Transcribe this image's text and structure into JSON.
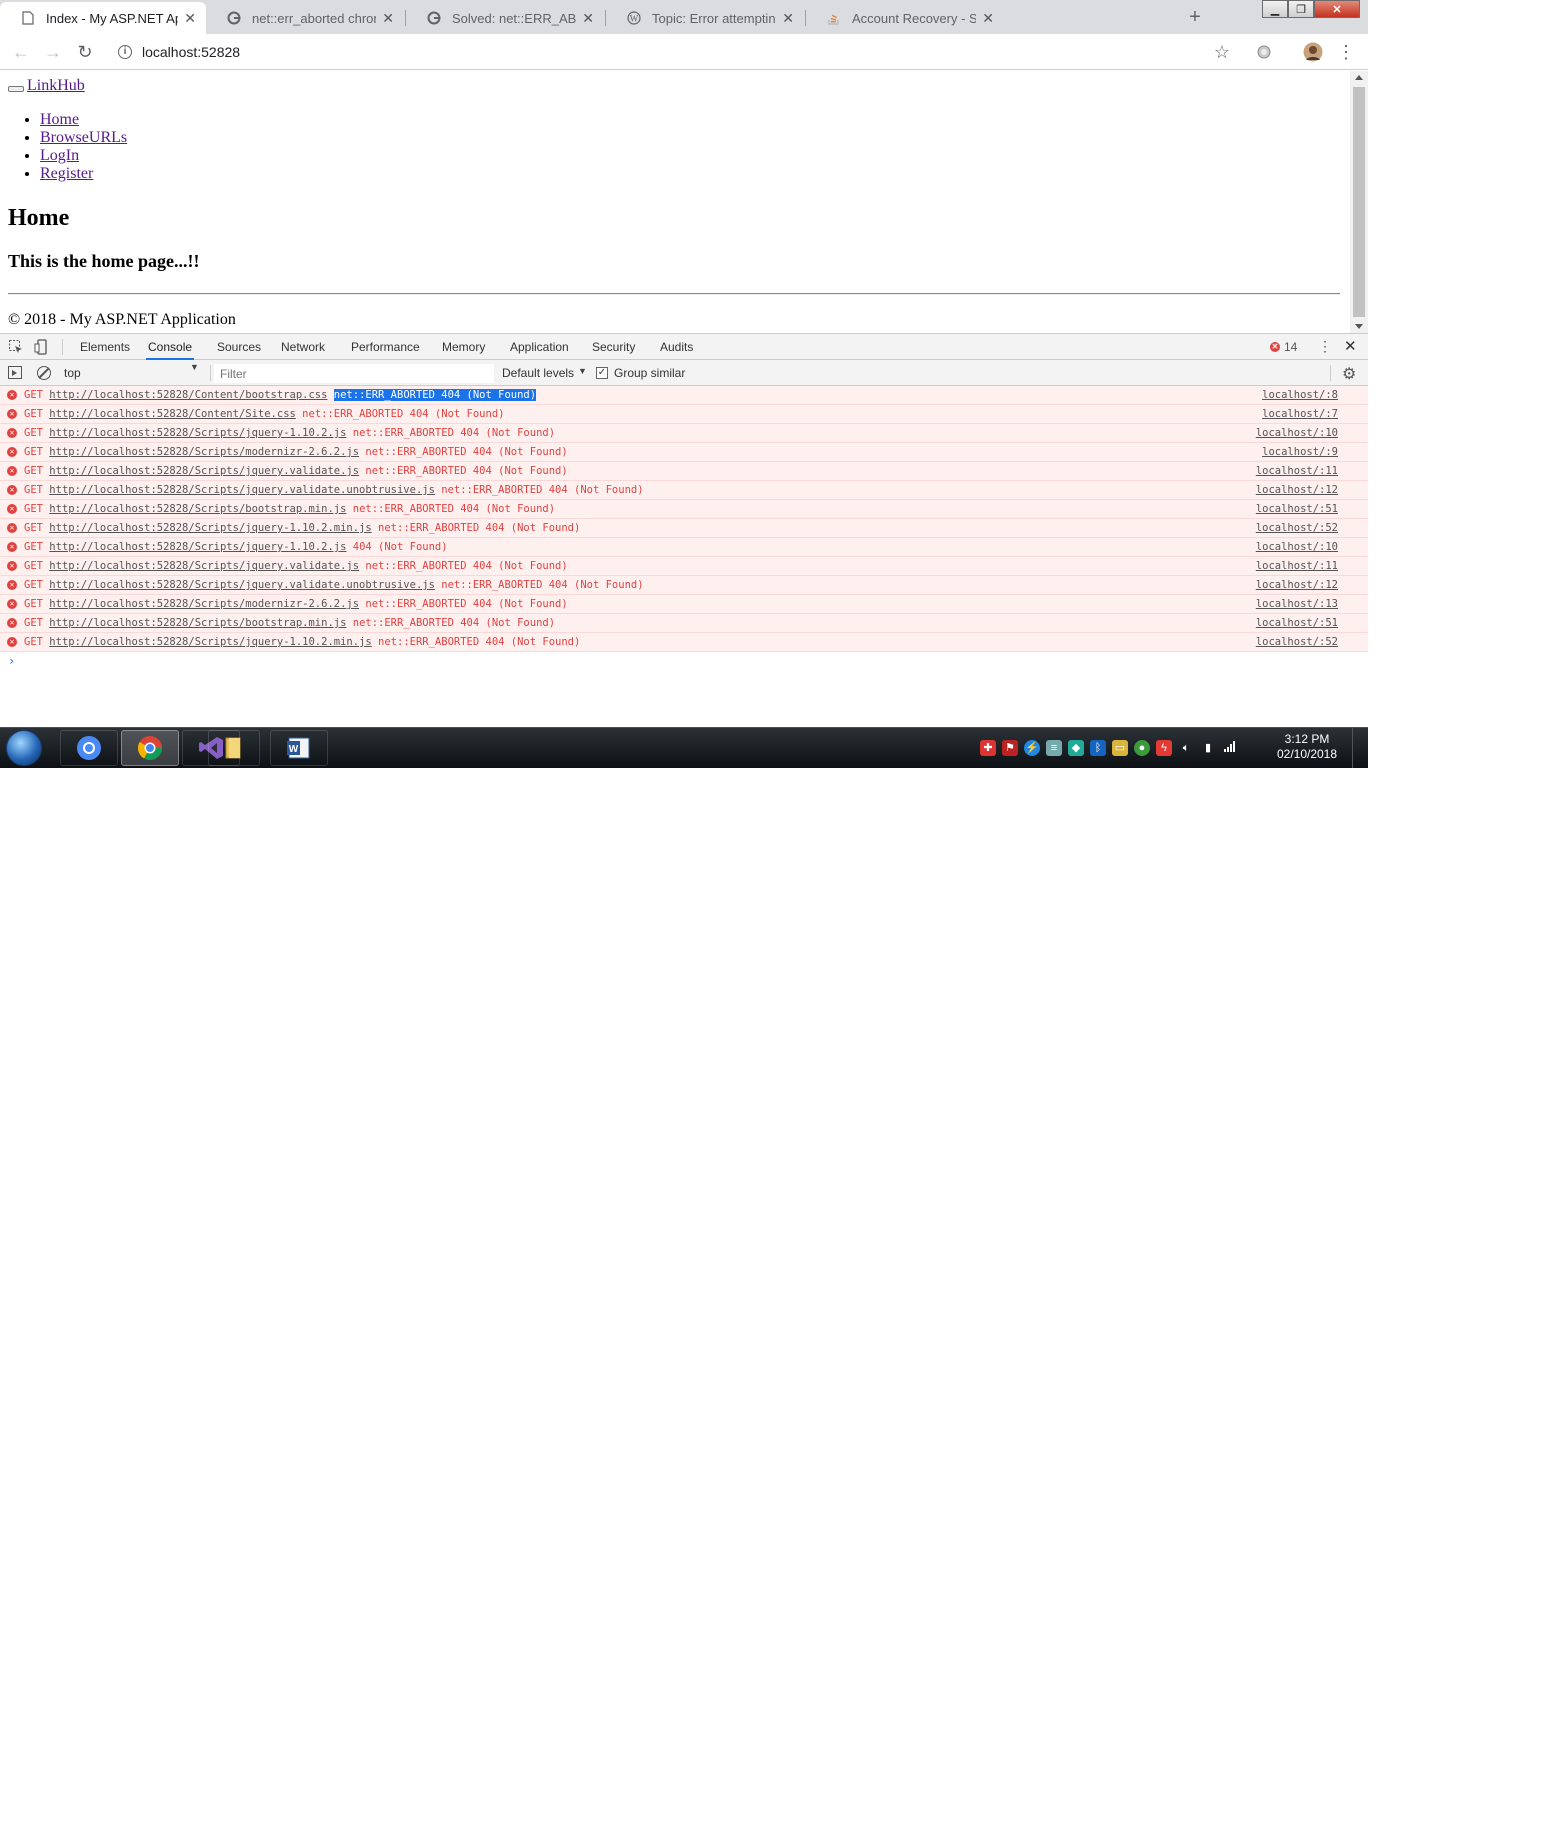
{
  "browser": {
    "tabs": [
      {
        "title": "Index - My ASP.NET Application",
        "icon": "page-icon",
        "active": true
      },
      {
        "title": "net::err_aborted chrome - G",
        "icon": "google-icon",
        "active": false
      },
      {
        "title": "Solved: net::ERR_ABORTED whi",
        "icon": "google-icon",
        "active": false
      },
      {
        "title": "Topic: Error attempting to load",
        "icon": "wordpress-icon",
        "active": false
      },
      {
        "title": "Account Recovery - Stack Overf",
        "icon": "stackoverflow-icon",
        "active": false
      }
    ],
    "url": "localhost:52828"
  },
  "page": {
    "brand": "LinkHub",
    "nav": [
      "Home",
      "BrowseURLs",
      "LogIn",
      "Register"
    ],
    "heading": "Home",
    "subheading": "This is the home page...!!",
    "footer": "© 2018 - My ASP.NET Application"
  },
  "devtools": {
    "tabs": [
      "Elements",
      "Console",
      "Sources",
      "Network",
      "Performance",
      "Memory",
      "Application",
      "Security",
      "Audits"
    ],
    "active_tab": "Console",
    "error_count": "14",
    "context": "top",
    "filter_placeholder": "Filter",
    "levels": "Default levels",
    "group_similar": "Group similar",
    "messages": [
      {
        "method": "GET",
        "url": "http://localhost:52828/Content/bootstrap.css",
        "text": "net::ERR_ABORTED 404 (Not Found)",
        "source": "localhost/:8",
        "selected": true
      },
      {
        "method": "GET",
        "url": "http://localhost:52828/Content/Site.css",
        "text": "net::ERR_ABORTED 404 (Not Found)",
        "source": "localhost/:7"
      },
      {
        "method": "GET",
        "url": "http://localhost:52828/Scripts/jquery-1.10.2.js",
        "text": "net::ERR_ABORTED 404 (Not Found)",
        "source": "localhost/:10"
      },
      {
        "method": "GET",
        "url": "http://localhost:52828/Scripts/modernizr-2.6.2.js",
        "text": "net::ERR_ABORTED 404 (Not Found)",
        "source": "localhost/:9"
      },
      {
        "method": "GET",
        "url": "http://localhost:52828/Scripts/jquery.validate.js",
        "text": "net::ERR_ABORTED 404 (Not Found)",
        "source": "localhost/:11"
      },
      {
        "method": "GET",
        "url": "http://localhost:52828/Scripts/jquery.validate.unobtrusive.js",
        "text": "net::ERR_ABORTED 404 (Not Found)",
        "source": "localhost/:12"
      },
      {
        "method": "GET",
        "url": "http://localhost:52828/Scripts/bootstrap.min.js",
        "text": "net::ERR_ABORTED 404 (Not Found)",
        "source": "localhost/:51"
      },
      {
        "method": "GET",
        "url": "http://localhost:52828/Scripts/jquery-1.10.2.min.js",
        "text": "net::ERR_ABORTED 404 (Not Found)",
        "source": "localhost/:52"
      },
      {
        "method": "GET",
        "url": "http://localhost:52828/Scripts/jquery-1.10.2.js",
        "text": "404 (Not Found)",
        "source": "localhost/:10"
      },
      {
        "method": "GET",
        "url": "http://localhost:52828/Scripts/jquery.validate.js",
        "text": "net::ERR_ABORTED 404 (Not Found)",
        "source": "localhost/:11"
      },
      {
        "method": "GET",
        "url": "http://localhost:52828/Scripts/jquery.validate.unobtrusive.js",
        "text": "net::ERR_ABORTED 404 (Not Found)",
        "source": "localhost/:12"
      },
      {
        "method": "GET",
        "url": "http://localhost:52828/Scripts/modernizr-2.6.2.js",
        "text": "net::ERR_ABORTED 404 (Not Found)",
        "source": "localhost/:13"
      },
      {
        "method": "GET",
        "url": "http://localhost:52828/Scripts/bootstrap.min.js",
        "text": "net::ERR_ABORTED 404 (Not Found)",
        "source": "localhost/:51"
      },
      {
        "method": "GET",
        "url": "http://localhost:52828/Scripts/jquery-1.10.2.min.js",
        "text": "net::ERR_ABORTED 404 (Not Found)",
        "source": "localhost/:52"
      }
    ],
    "prompt": "›"
  },
  "taskbar": {
    "apps": [
      "chromium-icon",
      "chrome-icon",
      "visual-studio-icon",
      "file-explorer-icon",
      "word-icon"
    ],
    "time": "3:12 PM",
    "date": "02/10/2018"
  },
  "colors": {
    "error_red": "#e0423f",
    "error_bg": "#fff0f0",
    "selection_blue": "#1a73e8",
    "link_visited": "#551a8b"
  }
}
